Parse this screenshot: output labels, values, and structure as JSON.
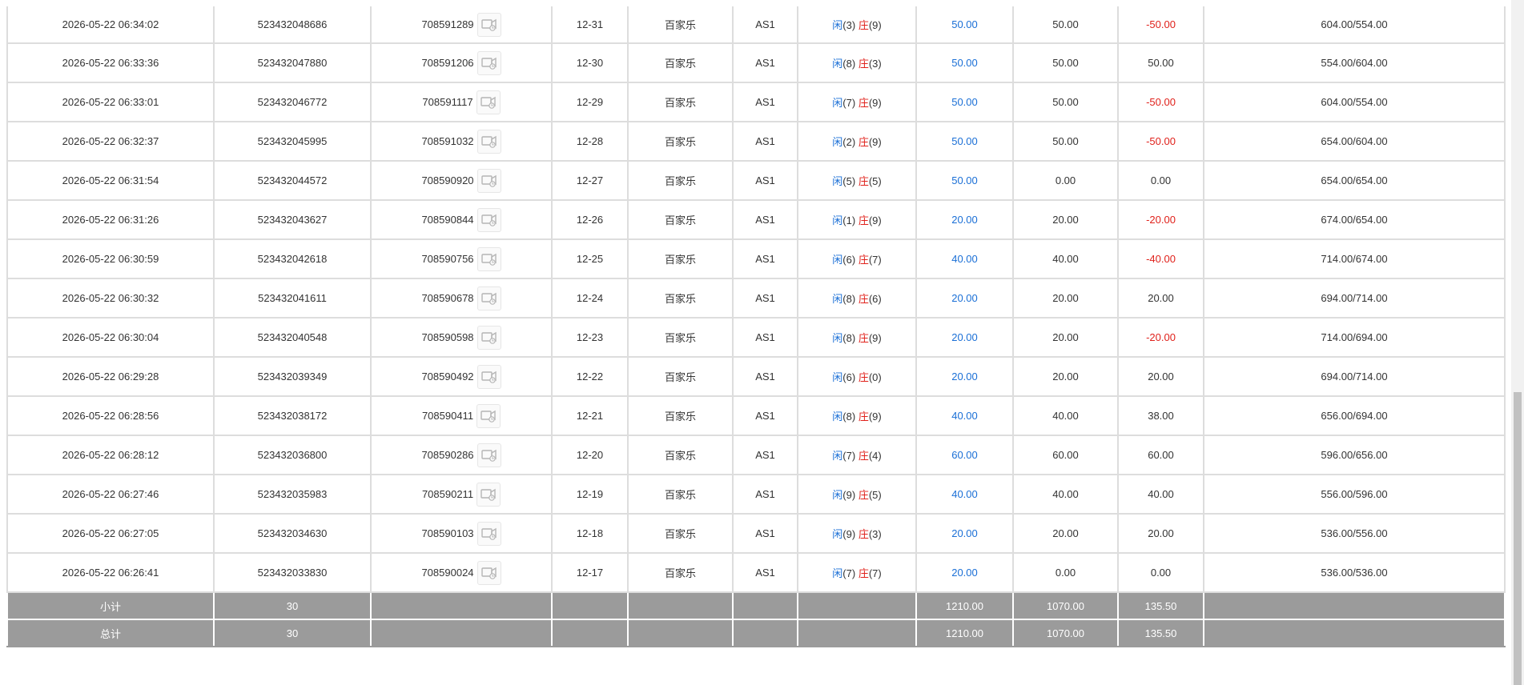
{
  "rows": [
    {
      "time": "2026-05-22 06:34:02",
      "order": "523432048686",
      "game_no": "708591289",
      "shoe": "12-31",
      "game": "百家乐",
      "table": "AS1",
      "player_label": "闲",
      "player_pts": "(3)",
      "banker_label": "庄",
      "banker_pts": "(9)",
      "bet": "50.00",
      "valid": "50.00",
      "win": "-50.00",
      "win_neg": true,
      "balance": "604.00/554.00"
    },
    {
      "time": "2026-05-22 06:33:36",
      "order": "523432047880",
      "game_no": "708591206",
      "shoe": "12-30",
      "game": "百家乐",
      "table": "AS1",
      "player_label": "闲",
      "player_pts": "(8)",
      "banker_label": "庄",
      "banker_pts": "(3)",
      "bet": "50.00",
      "valid": "50.00",
      "win": "50.00",
      "win_neg": false,
      "balance": "554.00/604.00"
    },
    {
      "time": "2026-05-22 06:33:01",
      "order": "523432046772",
      "game_no": "708591117",
      "shoe": "12-29",
      "game": "百家乐",
      "table": "AS1",
      "player_label": "闲",
      "player_pts": "(7)",
      "banker_label": "庄",
      "banker_pts": "(9)",
      "bet": "50.00",
      "valid": "50.00",
      "win": "-50.00",
      "win_neg": true,
      "balance": "604.00/554.00"
    },
    {
      "time": "2026-05-22 06:32:37",
      "order": "523432045995",
      "game_no": "708591032",
      "shoe": "12-28",
      "game": "百家乐",
      "table": "AS1",
      "player_label": "闲",
      "player_pts": "(2)",
      "banker_label": "庄",
      "banker_pts": "(9)",
      "bet": "50.00",
      "valid": "50.00",
      "win": "-50.00",
      "win_neg": true,
      "balance": "654.00/604.00"
    },
    {
      "time": "2026-05-22 06:31:54",
      "order": "523432044572",
      "game_no": "708590920",
      "shoe": "12-27",
      "game": "百家乐",
      "table": "AS1",
      "player_label": "闲",
      "player_pts": "(5)",
      "banker_label": "庄",
      "banker_pts": "(5)",
      "bet": "50.00",
      "valid": "0.00",
      "win": "0.00",
      "win_neg": false,
      "balance": "654.00/654.00"
    },
    {
      "time": "2026-05-22 06:31:26",
      "order": "523432043627",
      "game_no": "708590844",
      "shoe": "12-26",
      "game": "百家乐",
      "table": "AS1",
      "player_label": "闲",
      "player_pts": "(1)",
      "banker_label": "庄",
      "banker_pts": "(9)",
      "bet": "20.00",
      "valid": "20.00",
      "win": "-20.00",
      "win_neg": true,
      "balance": "674.00/654.00"
    },
    {
      "time": "2026-05-22 06:30:59",
      "order": "523432042618",
      "game_no": "708590756",
      "shoe": "12-25",
      "game": "百家乐",
      "table": "AS1",
      "player_label": "闲",
      "player_pts": "(6)",
      "banker_label": "庄",
      "banker_pts": "(7)",
      "bet": "40.00",
      "valid": "40.00",
      "win": "-40.00",
      "win_neg": true,
      "balance": "714.00/674.00"
    },
    {
      "time": "2026-05-22 06:30:32",
      "order": "523432041611",
      "game_no": "708590678",
      "shoe": "12-24",
      "game": "百家乐",
      "table": "AS1",
      "player_label": "闲",
      "player_pts": "(8)",
      "banker_label": "庄",
      "banker_pts": "(6)",
      "bet": "20.00",
      "valid": "20.00",
      "win": "20.00",
      "win_neg": false,
      "balance": "694.00/714.00"
    },
    {
      "time": "2026-05-22 06:30:04",
      "order": "523432040548",
      "game_no": "708590598",
      "shoe": "12-23",
      "game": "百家乐",
      "table": "AS1",
      "player_label": "闲",
      "player_pts": "(8)",
      "banker_label": "庄",
      "banker_pts": "(9)",
      "bet": "20.00",
      "valid": "20.00",
      "win": "-20.00",
      "win_neg": true,
      "balance": "714.00/694.00"
    },
    {
      "time": "2026-05-22 06:29:28",
      "order": "523432039349",
      "game_no": "708590492",
      "shoe": "12-22",
      "game": "百家乐",
      "table": "AS1",
      "player_label": "闲",
      "player_pts": "(6)",
      "banker_label": "庄",
      "banker_pts": "(0)",
      "bet": "20.00",
      "valid": "20.00",
      "win": "20.00",
      "win_neg": false,
      "balance": "694.00/714.00"
    },
    {
      "time": "2026-05-22 06:28:56",
      "order": "523432038172",
      "game_no": "708590411",
      "shoe": "12-21",
      "game": "百家乐",
      "table": "AS1",
      "player_label": "闲",
      "player_pts": "(8)",
      "banker_label": "庄",
      "banker_pts": "(9)",
      "bet": "40.00",
      "valid": "40.00",
      "win": "38.00",
      "win_neg": false,
      "balance": "656.00/694.00"
    },
    {
      "time": "2026-05-22 06:28:12",
      "order": "523432036800",
      "game_no": "708590286",
      "shoe": "12-20",
      "game": "百家乐",
      "table": "AS1",
      "player_label": "闲",
      "player_pts": "(7)",
      "banker_label": "庄",
      "banker_pts": "(4)",
      "bet": "60.00",
      "valid": "60.00",
      "win": "60.00",
      "win_neg": false,
      "balance": "596.00/656.00"
    },
    {
      "time": "2026-05-22 06:27:46",
      "order": "523432035983",
      "game_no": "708590211",
      "shoe": "12-19",
      "game": "百家乐",
      "table": "AS1",
      "player_label": "闲",
      "player_pts": "(9)",
      "banker_label": "庄",
      "banker_pts": "(5)",
      "bet": "40.00",
      "valid": "40.00",
      "win": "40.00",
      "win_neg": false,
      "balance": "556.00/596.00"
    },
    {
      "time": "2026-05-22 06:27:05",
      "order": "523432034630",
      "game_no": "708590103",
      "shoe": "12-18",
      "game": "百家乐",
      "table": "AS1",
      "player_label": "闲",
      "player_pts": "(9)",
      "banker_label": "庄",
      "banker_pts": "(3)",
      "bet": "20.00",
      "valid": "20.00",
      "win": "20.00",
      "win_neg": false,
      "balance": "536.00/556.00"
    },
    {
      "time": "2026-05-22 06:26:41",
      "order": "523432033830",
      "game_no": "708590024",
      "shoe": "12-17",
      "game": "百家乐",
      "table": "AS1",
      "player_label": "闲",
      "player_pts": "(7)",
      "banker_label": "庄",
      "banker_pts": "(7)",
      "bet": "20.00",
      "valid": "0.00",
      "win": "0.00",
      "win_neg": false,
      "balance": "536.00/536.00"
    }
  ],
  "summary": [
    {
      "label": "小计",
      "count": "30",
      "bet": "1210.00",
      "valid": "1070.00",
      "win": "135.50"
    },
    {
      "label": "总计",
      "count": "30",
      "bet": "1210.00",
      "valid": "1070.00",
      "win": "135.50"
    }
  ],
  "colors": {
    "player_blue": "#1a6fd6",
    "banker_red": "#e0211b",
    "summary_bg": "#9b9b9b",
    "border": "#dddddd"
  },
  "icons": {
    "replay": "video-replay-icon"
  },
  "scrollbar": {
    "position": 0.57
  }
}
